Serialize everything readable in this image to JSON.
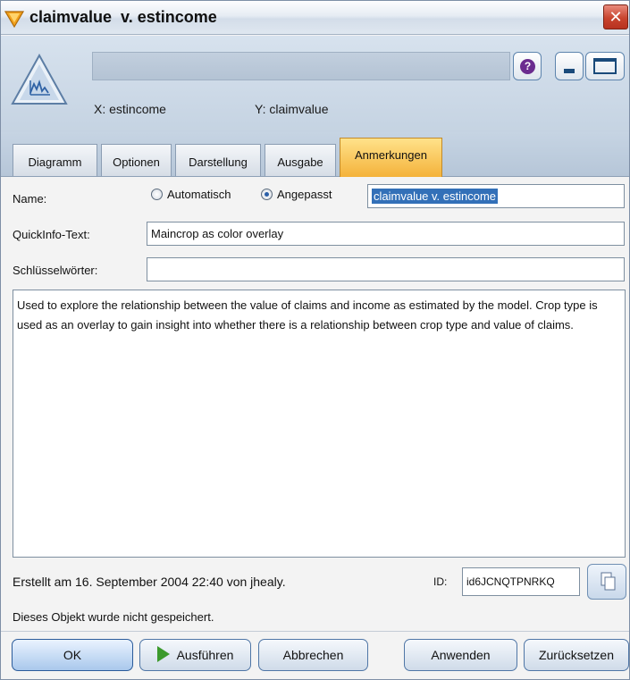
{
  "window": {
    "title": "claimvalue  v. estincome",
    "close_glyph": "✕"
  },
  "header": {
    "x_label": "X: estincome",
    "y_label": "Y: claimvalue",
    "help_glyph": "?"
  },
  "tabs": [
    {
      "label": "Diagramm",
      "active": false
    },
    {
      "label": "Optionen",
      "active": false
    },
    {
      "label": "Darstellung",
      "active": false
    },
    {
      "label": "Ausgabe",
      "active": false
    },
    {
      "label": "Anmerkungen",
      "active": true
    }
  ],
  "form": {
    "name_label": "Name:",
    "radio_auto_label": "Automatisch",
    "radio_custom_label": "Angepasst",
    "name_selected": "custom",
    "name_value": "claimvalue  v. estincome",
    "tooltip_label": "QuickInfo-Text:",
    "tooltip_value": "Maincrop as color overlay",
    "keywords_label": "Schlüsselwörter:",
    "keywords_value": "",
    "description": "Used to explore the relationship between the value of claims and income as estimated by the model. Crop type is used as an overlay to gain insight into whether there is a relationship between crop type and value of claims.",
    "created_text": "Erstellt am 16. September 2004 22:40 von jhealy.",
    "id_label": "ID:",
    "id_value": "id6JCNQTPNRKQ",
    "saved_status": "Dieses Objekt wurde nicht gespeichert."
  },
  "buttons": {
    "ok": "OK",
    "run": "Ausführen",
    "cancel": "Abbrechen",
    "apply": "Anwenden",
    "reset": "Zurücksetzen"
  }
}
